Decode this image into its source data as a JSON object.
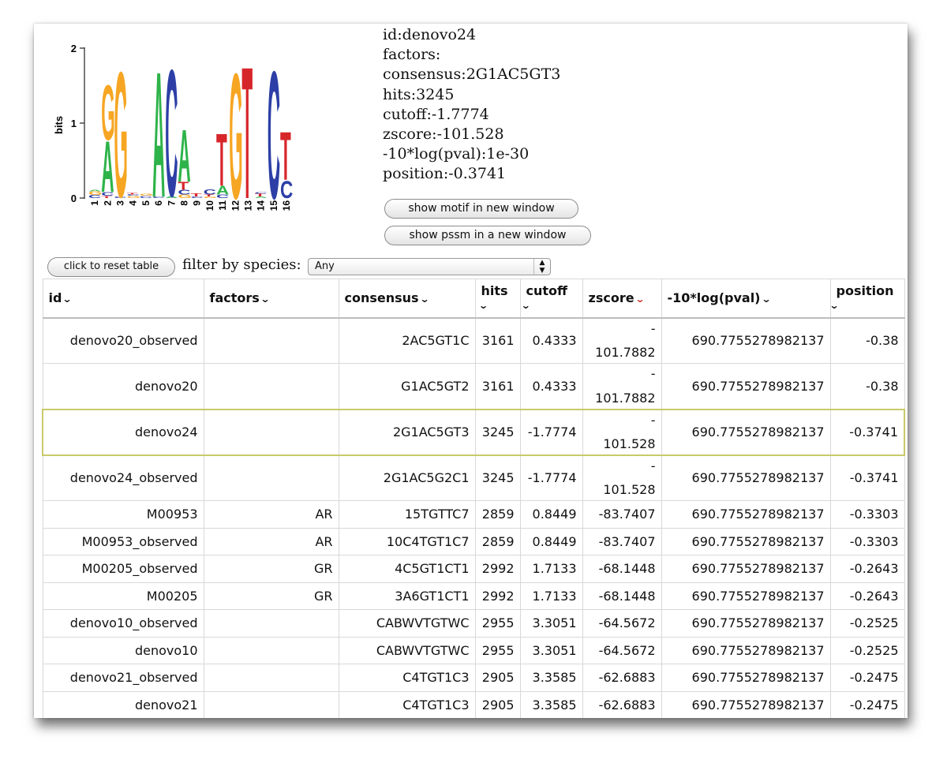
{
  "logo": {
    "y_axis_label": "bits",
    "y_ticks": [
      "2",
      "1",
      "0"
    ],
    "positions": [
      "1",
      "2",
      "3",
      "4",
      "5",
      "6",
      "7",
      "8",
      "9",
      "10",
      "11",
      "12",
      "13",
      "14",
      "15",
      "16"
    ],
    "colors": {
      "A": "#2eb34a",
      "C": "#2d3fa6",
      "G": "#f6a623",
      "T": "#d7262a"
    }
  },
  "motif": {
    "id": "id:denovo24",
    "factors": "factors:",
    "consensus": "consensus:2G1AC5GT3",
    "hits": "hits:3245",
    "cutoff": "cutoff:-1.7774",
    "zscore": "zscore:-101.528",
    "pval": "-10*log(pval):1e-30",
    "position": "position:-0.3741"
  },
  "buttons": {
    "show_motif": "show motif in new window",
    "show_pssm": "show pssm in a new window",
    "reset_table": "click to reset table"
  },
  "filter": {
    "label": "filter by species:",
    "selected": "Any"
  },
  "table": {
    "headers": {
      "id": "id",
      "factors": "factors",
      "consensus": "consensus",
      "hits": "hits",
      "cutoff": "cutoff",
      "zscore": "zscore",
      "pval": "-10*log(pval)",
      "position": "position"
    },
    "sorted_column": "zscore",
    "rows": [
      {
        "id": "denovo20_observed",
        "factors": "",
        "consensus": "2AC5GT1C",
        "hits": "3161",
        "cutoff": "0.4333",
        "zscore": "-101.7882",
        "pval": "690.7755278982137",
        "position": "-0.38"
      },
      {
        "id": "denovo20",
        "factors": "",
        "consensus": "G1AC5GT2",
        "hits": "3161",
        "cutoff": "0.4333",
        "zscore": "-101.7882",
        "pval": "690.7755278982137",
        "position": "-0.38"
      },
      {
        "id": "denovo24",
        "factors": "",
        "consensus": "2G1AC5GT3",
        "hits": "3245",
        "cutoff": "-1.7774",
        "zscore": "-101.528",
        "pval": "690.7755278982137",
        "position": "-0.3741",
        "selected": true
      },
      {
        "id": "denovo24_observed",
        "factors": "",
        "consensus": "2G1AC5G2C1",
        "hits": "3245",
        "cutoff": "-1.7774",
        "zscore": "-101.528",
        "pval": "690.7755278982137",
        "position": "-0.3741"
      },
      {
        "id": "M00953",
        "factors": "AR",
        "consensus": "15TGTTC7",
        "hits": "2859",
        "cutoff": "0.8449",
        "zscore": "-83.7407",
        "pval": "690.7755278982137",
        "position": "-0.3303"
      },
      {
        "id": "M00953_observed",
        "factors": "AR",
        "consensus": "10C4TGT1C7",
        "hits": "2859",
        "cutoff": "0.8449",
        "zscore": "-83.7407",
        "pval": "690.7755278982137",
        "position": "-0.3303"
      },
      {
        "id": "M00205_observed",
        "factors": "GR",
        "consensus": "4C5GT1CT1",
        "hits": "2992",
        "cutoff": "1.7133",
        "zscore": "-68.1448",
        "pval": "690.7755278982137",
        "position": "-0.2643"
      },
      {
        "id": "M00205",
        "factors": "GR",
        "consensus": "3A6GT1CT1",
        "hits": "2992",
        "cutoff": "1.7133",
        "zscore": "-68.1448",
        "pval": "690.7755278982137",
        "position": "-0.2643"
      },
      {
        "id": "denovo10_observed",
        "factors": "",
        "consensus": "CABWVTGTWC",
        "hits": "2955",
        "cutoff": "3.3051",
        "zscore": "-64.5672",
        "pval": "690.7755278982137",
        "position": "-0.2525"
      },
      {
        "id": "denovo10",
        "factors": "",
        "consensus": "CABWVTGTWC",
        "hits": "2955",
        "cutoff": "3.3051",
        "zscore": "-64.5672",
        "pval": "690.7755278982137",
        "position": "-0.2525"
      },
      {
        "id": "denovo21_observed",
        "factors": "",
        "consensus": "C4TGT1C3",
        "hits": "2905",
        "cutoff": "3.3585",
        "zscore": "-62.6883",
        "pval": "690.7755278982137",
        "position": "-0.2475"
      },
      {
        "id": "denovo21",
        "factors": "",
        "consensus": "C4TGT1C3",
        "hits": "2905",
        "cutoff": "3.3585",
        "zscore": "-62.6883",
        "pval": "690.7755278982137",
        "position": "-0.2475"
      }
    ]
  }
}
